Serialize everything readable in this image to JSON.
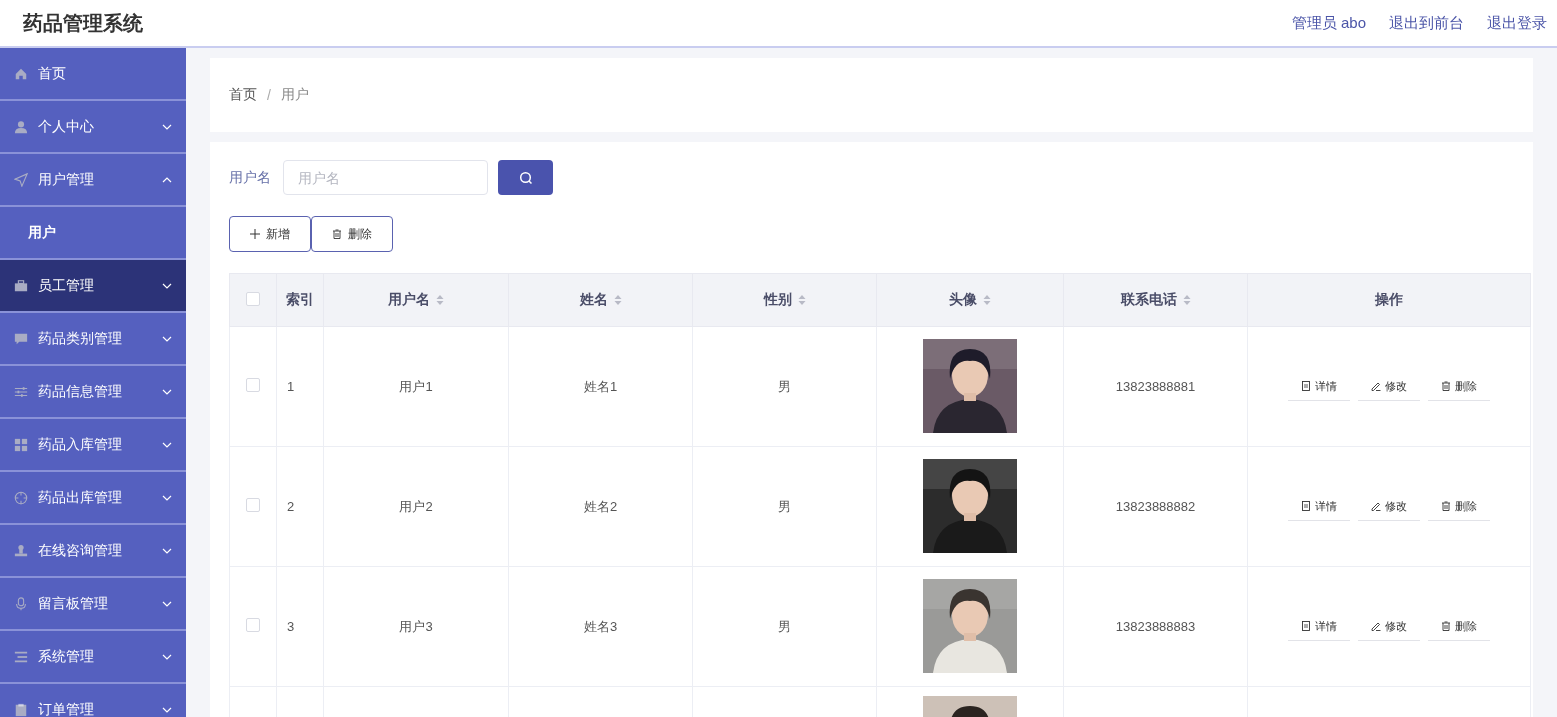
{
  "header": {
    "title": "药品管理系统",
    "links": [
      "管理员 abo",
      "退出到前台",
      "退出登录"
    ]
  },
  "sidebar": {
    "items": [
      {
        "kind": "link",
        "label": "首页",
        "selected": false
      },
      {
        "kind": "submenu",
        "label": "个人中心",
        "expanded": false,
        "selected": false
      },
      {
        "kind": "submenu",
        "label": "用户管理",
        "expanded": true,
        "selected": false,
        "children": [
          {
            "label": "用户",
            "selected": false
          }
        ]
      },
      {
        "kind": "submenu",
        "label": "员工管理",
        "expanded": false,
        "selected": true
      },
      {
        "kind": "submenu",
        "label": "药品类别管理",
        "expanded": false,
        "selected": false
      },
      {
        "kind": "submenu",
        "label": "药品信息管理",
        "expanded": false,
        "selected": false
      },
      {
        "kind": "submenu",
        "label": "药品入库管理",
        "expanded": false,
        "selected": false
      },
      {
        "kind": "submenu",
        "label": "药品出库管理",
        "expanded": false,
        "selected": false
      },
      {
        "kind": "submenu",
        "label": "在线咨询管理",
        "expanded": false,
        "selected": false
      },
      {
        "kind": "submenu",
        "label": "留言板管理",
        "expanded": false,
        "selected": false
      },
      {
        "kind": "submenu",
        "label": "系统管理",
        "expanded": false,
        "selected": false
      },
      {
        "kind": "submenu",
        "label": "订单管理",
        "expanded": false,
        "selected": false
      }
    ]
  },
  "breadcrumb": {
    "items": [
      "首页",
      "用户"
    ],
    "separator": "/"
  },
  "search": {
    "label": "用户名",
    "placeholder": "用户名"
  },
  "actions": [
    "新增",
    "删除"
  ],
  "table": {
    "select_all": {
      "checked": false
    },
    "columns": [
      {
        "label": "索引",
        "sortable": false
      },
      {
        "label": "用户名",
        "sortable": true
      },
      {
        "label": "姓名",
        "sortable": true
      },
      {
        "label": "性别",
        "sortable": true
      },
      {
        "label": "头像",
        "sortable": true
      },
      {
        "label": "联系电话",
        "sortable": true
      },
      {
        "label": "操作",
        "sortable": false
      }
    ],
    "rows": [
      {
        "checked": false,
        "index": "1",
        "username": "用户1",
        "name": "姓名1",
        "gender": "男",
        "avatar": {
          "kind": "picture"
        },
        "phone": "13823888881",
        "ops": [
          "详情",
          "修改",
          "删除"
        ]
      },
      {
        "checked": false,
        "index": "2",
        "username": "用户2",
        "name": "姓名2",
        "gender": "男",
        "avatar": {
          "kind": "picture"
        },
        "phone": "13823888882",
        "ops": [
          "详情",
          "修改",
          "删除"
        ]
      },
      {
        "checked": false,
        "index": "3",
        "username": "用户3",
        "name": "姓名3",
        "gender": "男",
        "avatar": {
          "kind": "picture"
        },
        "phone": "13823888883",
        "ops": [
          "详情",
          "修改",
          "删除"
        ]
      },
      {
        "avatar": {
          "kind": "picture"
        }
      }
    ]
  }
}
